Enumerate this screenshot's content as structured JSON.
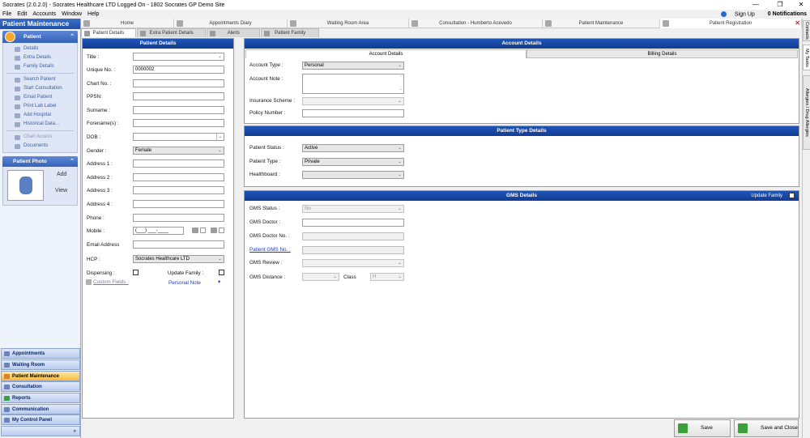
{
  "window": {
    "title": "Socrates (2.0.2.0) - Socrates Healthcare LTD Logged On - 1802 Socrates GP Demo Site"
  },
  "menu": {
    "items": [
      "File",
      "Edit",
      "Accounts",
      "Window",
      "Help"
    ],
    "sign_up": "Sign Up",
    "notifications": "0 Notifications"
  },
  "left": {
    "title": "Patient Maintenance",
    "patient_group": "Patient",
    "patient_items": [
      "Details",
      "Extra Details",
      "Family Details"
    ],
    "action_items": [
      "Search Patient",
      "Start Consultation",
      "Email Patient",
      "Print Lab Label",
      "Add Hospital",
      "Historical Data..."
    ],
    "other_items": [
      "Chart Access",
      "Documents"
    ],
    "photo_group": "Patient Photo",
    "photo_add": "Add",
    "photo_view": "View",
    "nav": [
      "Appointments",
      "Waiting Room",
      "Patient Maintenance",
      "Consultation",
      "Reports",
      "Communication",
      "My Control Panel"
    ]
  },
  "tabs1": [
    "Home",
    "Appointments Diary",
    "Waiting Room Area",
    "Consultation - Humberto Acevedo",
    "Patient Maintenance",
    "Patient Registration"
  ],
  "tabs2": [
    "Patient Details",
    "Extra Patient Details",
    "Alerts",
    "Patient Family"
  ],
  "right_tabs": [
    "Contacts",
    "My Tasks",
    "Allergies / Drug Allergies"
  ],
  "patient_details": {
    "header": "Patient Details",
    "title": "Title :",
    "unique_no": "Unique No. :",
    "unique_no_value": "0000002",
    "chart_no": "Chart No. :",
    "ppsn": "PPSN:",
    "surname": "Surname :",
    "forenames": "Forename(s) :",
    "dob": "DOB :",
    "gender": "Gender :",
    "gender_value": "Female",
    "address1": "Address 1 :",
    "address2": "Address 2 :",
    "address3": "Address 3 :",
    "address4": "Address 4 :",
    "phone": "Phone :",
    "mobile": "Mobile :",
    "mobile_value": "(___) ___-____",
    "email": "Email Address",
    "hcp": "HCP :",
    "hcp_value": "Socrates Healthcare LTD",
    "dispensing": "Dispensing :",
    "update_family": "Update Family :",
    "custom_fields": "Custom Fields :",
    "personal_note": "Personal Note"
  },
  "account": {
    "header": "Account Details",
    "tab_account": "Account Details",
    "tab_billing": "Billing Details",
    "account_type": "Account Type :",
    "account_type_value": "Personal",
    "account_note": "Account Note :",
    "insurance": "Insurance Scheme :",
    "policy": "Policy Number :"
  },
  "patient_type": {
    "header": "Patient Type  Details",
    "status": "Patient Status :",
    "status_value": "Active",
    "type": "Patient Type :",
    "type_value": "Private",
    "healthboard": "Healthboard :"
  },
  "gms": {
    "header": "GMS Details",
    "update_family": "Update Family",
    "status": "GMS Status :",
    "status_value": "No",
    "doctor": "GMS Doctor :",
    "doctor_no": "GMS Doctor No. :",
    "patient_gms_no": "Patient GMS No. :",
    "review": "GMS Review :",
    "distance": "GMS Distance :",
    "class": "Class",
    "class_value": "H"
  },
  "buttons": {
    "save": "Save",
    "save_close": "Save and Close"
  }
}
